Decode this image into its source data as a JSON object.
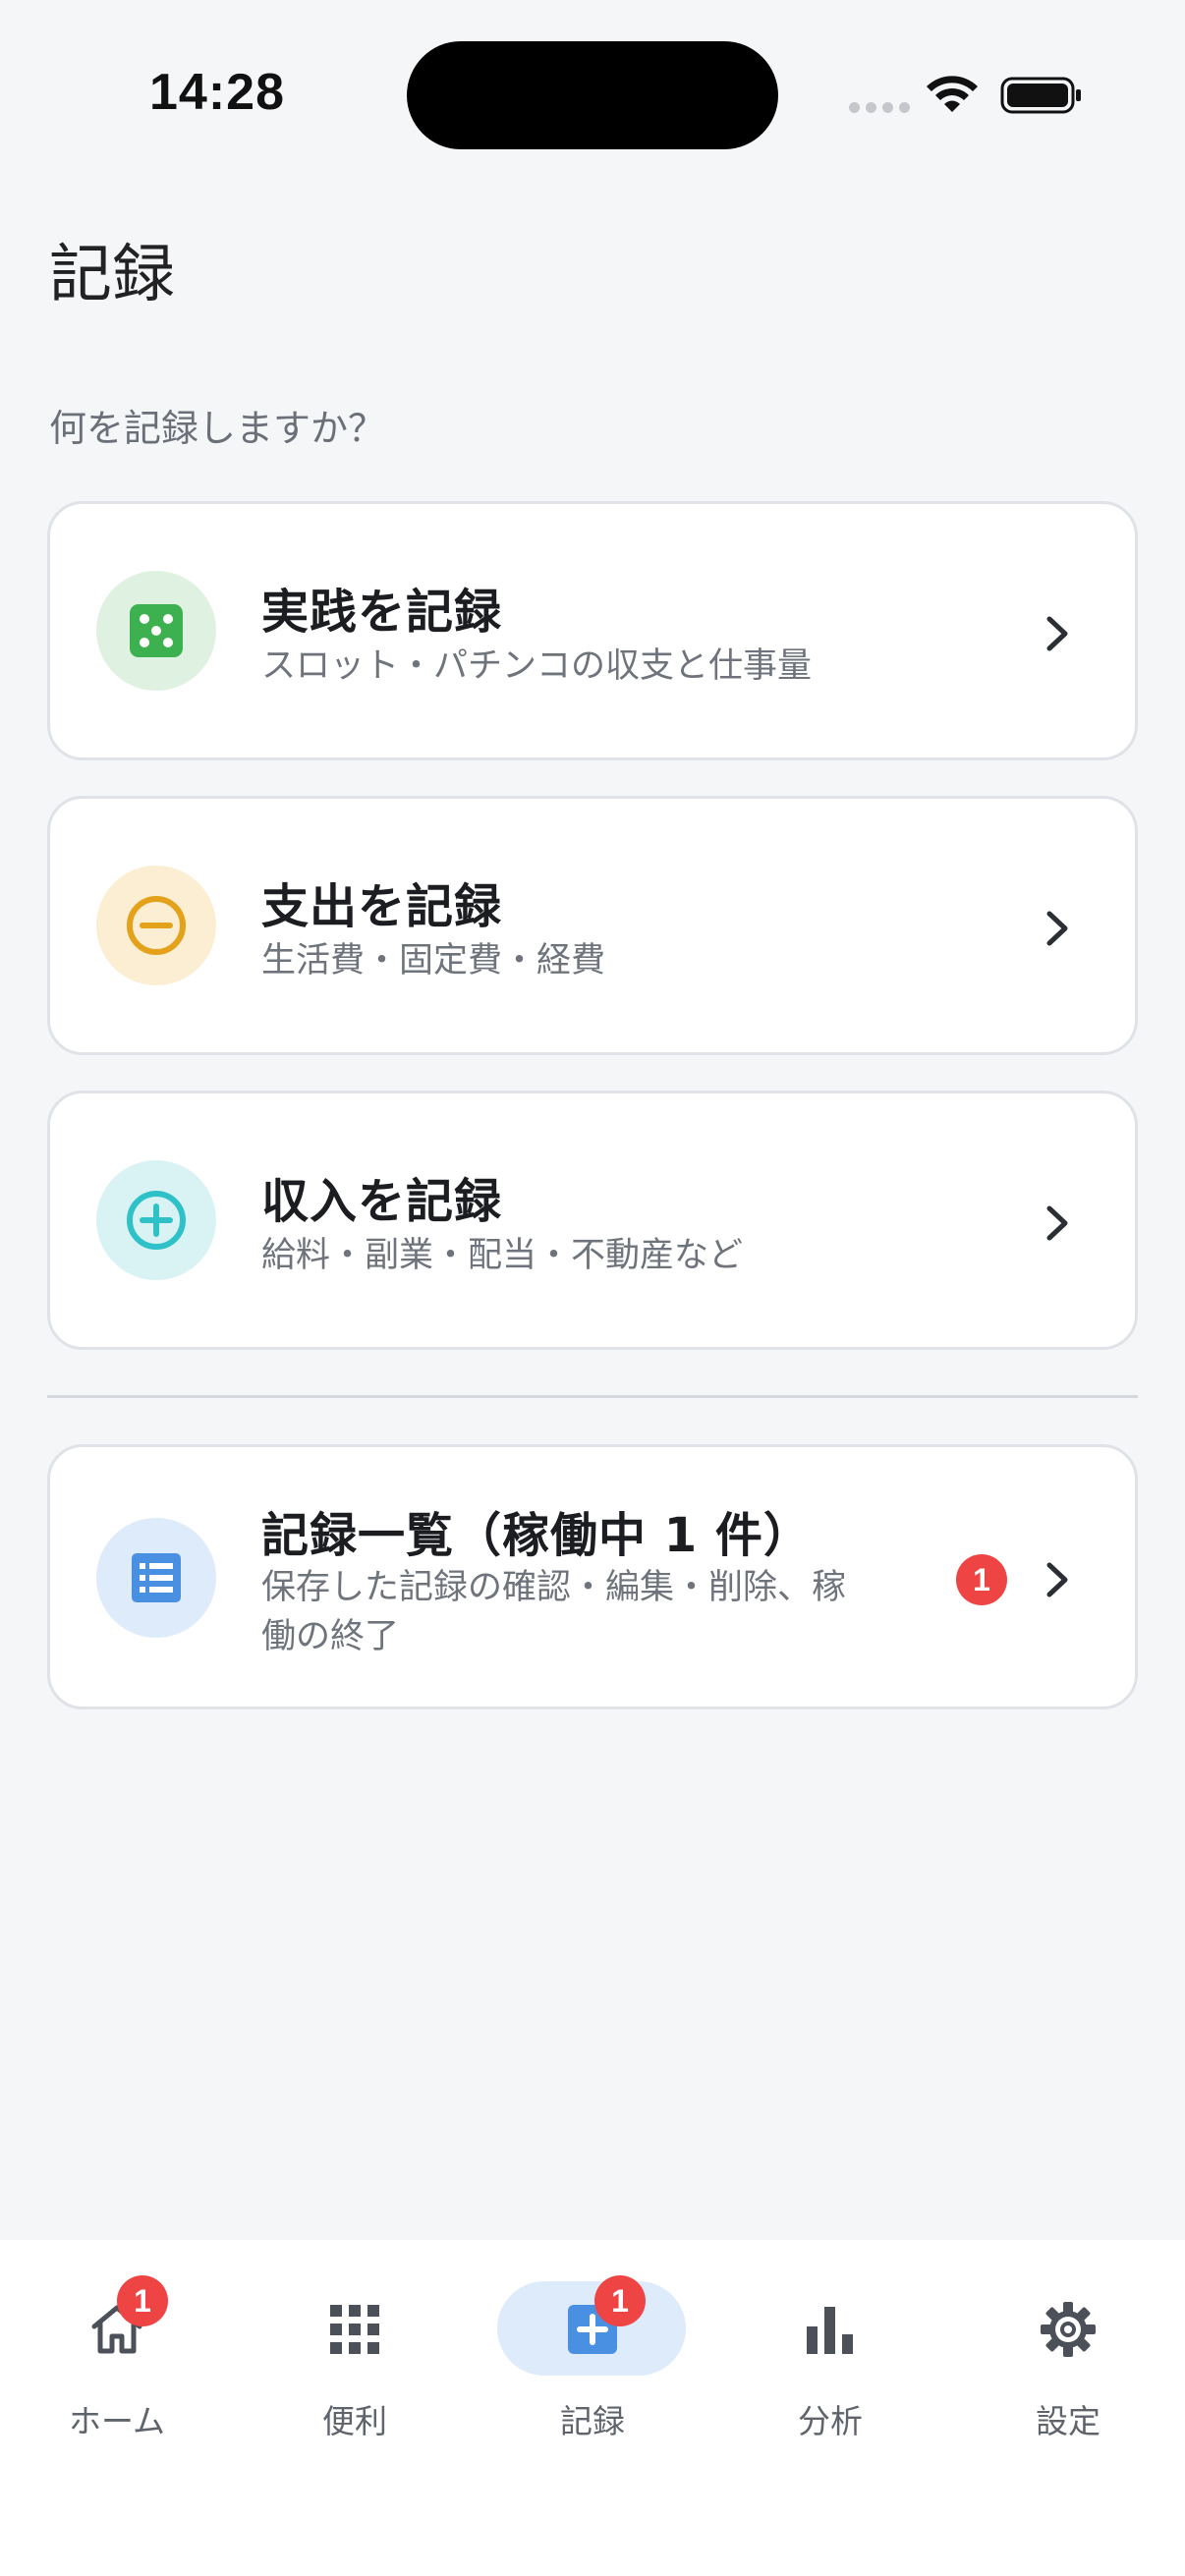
{
  "status": {
    "time": "14:28"
  },
  "header": {
    "title": "記録",
    "prompt": "何を記録しますか？"
  },
  "cards": [
    {
      "title": "実践を記録",
      "subtitle": "スロット・パチンコの収支と仕事量",
      "icon": "dice-icon",
      "color": "#3db14f"
    },
    {
      "title": "支出を記録",
      "subtitle": "生活費・固定費・経費",
      "icon": "minus-circle-icon",
      "color": "#e3a21a"
    },
    {
      "title": "収入を記録",
      "subtitle": "給料・副業・配当・不動産など",
      "icon": "plus-circle-icon",
      "color": "#2fc1c8"
    },
    {
      "title": "記録一覧（稼働中 1 件）",
      "subtitle_line1": "保存した記録の確認・編集・削除、稼",
      "subtitle_line2": "働の終了",
      "icon": "list-icon",
      "color": "#4a90e2",
      "badge": "1"
    }
  ],
  "tabbar": {
    "items": [
      {
        "label": "ホーム",
        "icon": "home-icon",
        "badge": "1"
      },
      {
        "label": "便利",
        "icon": "grid-icon"
      },
      {
        "label": "記録",
        "icon": "add-square-icon",
        "badge": "1",
        "active": true
      },
      {
        "label": "分析",
        "icon": "bar-chart-icon"
      },
      {
        "label": "設定",
        "icon": "gear-icon"
      }
    ]
  }
}
